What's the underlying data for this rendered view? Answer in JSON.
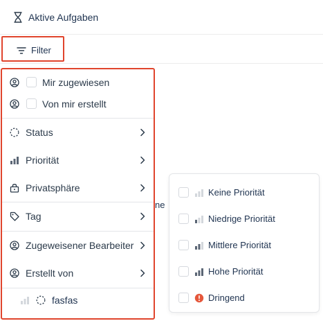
{
  "header": {
    "title": "Aktive Aufgaben",
    "icon": "hourglass-icon"
  },
  "filter_button": {
    "label": "Filter",
    "icon": "filter-lines-icon"
  },
  "dropdown": {
    "checkbox_items": [
      {
        "label": "Mir zugewiesen",
        "icon": "user-circle-icon",
        "checked": false
      },
      {
        "label": "Von mir erstellt",
        "icon": "user-circle-icon",
        "checked": false
      }
    ],
    "menu_items": [
      {
        "label": "Status",
        "icon": "dashed-circle-icon"
      },
      {
        "label": "Priorität",
        "icon": "bar-signal-icon"
      },
      {
        "label": "Privatsphäre",
        "icon": "lock-icon"
      },
      {
        "label": "Tag",
        "icon": "tag-icon"
      },
      {
        "label": "Zugeweisener Bearbeiter",
        "icon": "user-circle-icon"
      },
      {
        "label": "Erstellt von",
        "icon": "user-circle-icon"
      }
    ],
    "task_preview": {
      "label": "fasfas"
    }
  },
  "background_partial_text": "ne",
  "priority_submenu": {
    "items": [
      {
        "label": "Keine Priorität",
        "icon": "priority-none-icon",
        "checked": false
      },
      {
        "label": "Niedrige Priorität",
        "icon": "priority-low-icon",
        "checked": false
      },
      {
        "label": "Mittlere Priorität",
        "icon": "priority-medium-icon",
        "checked": false
      },
      {
        "label": "Hohe Priorität",
        "icon": "priority-high-icon",
        "checked": false
      },
      {
        "label": "Dringend",
        "icon": "urgent-icon",
        "checked": false
      }
    ]
  },
  "colors": {
    "highlight": "#e0442c",
    "urgent": "#e5573b",
    "text": "#2b3a4a",
    "bar_active": "#5b6675",
    "bar_inactive": "#d3d7dc"
  }
}
